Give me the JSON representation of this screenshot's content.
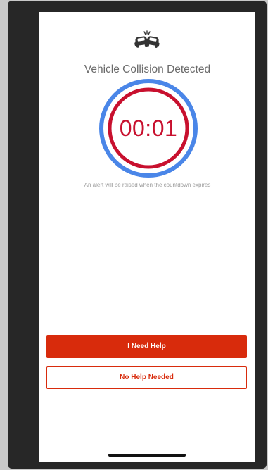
{
  "screen": {
    "icon": "car-collision-icon",
    "title": "Vehicle Collision Detected",
    "countdown": "00:01",
    "alert_note": "An alert will be raised when the countdown expires"
  },
  "actions": {
    "primary_label": "I Need Help",
    "secondary_label": "No Help Needed"
  },
  "colors": {
    "accent": "#d82b0c",
    "timer_text": "#c8102e",
    "timer_ring_outer": "#4a86e8",
    "timer_ring_inner": "#c8102e"
  }
}
